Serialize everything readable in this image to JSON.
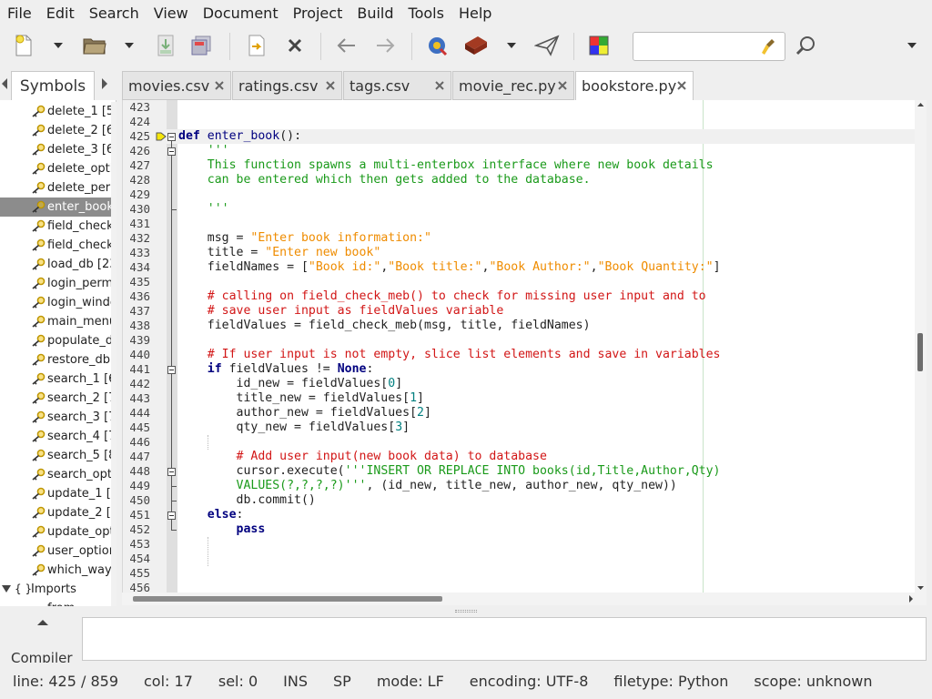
{
  "menu": [
    "File",
    "Edit",
    "Search",
    "View",
    "Document",
    "Project",
    "Build",
    "Tools",
    "Help"
  ],
  "toolbar": {
    "icons": [
      "new-file-icon",
      "new-dropdown-icon",
      "open-file-icon",
      "open-dropdown-icon",
      "save-icon",
      "save-all-icon",
      "revert-icon",
      "close-icon",
      "back-icon",
      "forward-icon",
      "compile-icon",
      "build-icon",
      "build-dropdown-icon",
      "run-icon",
      "color-chooser-icon"
    ],
    "search_value": ""
  },
  "sidebar": {
    "tab_label": "Symbols",
    "items": [
      "delete_1 [5",
      "delete_2 [6",
      "delete_3 [6",
      "delete_optic",
      "delete_perm",
      "enter_book",
      "field_check_",
      "field_check_",
      "load_db [23",
      "login_permi",
      "login_windo",
      "main_menu",
      "populate_dl",
      "restore_db",
      "search_1 [6",
      "search_2 [7",
      "search_3 [7",
      "search_4 [7",
      "search_5 [8",
      "search_opti",
      "update_1 [4",
      "update_2 [5",
      "update_opt",
      "user_option",
      "which_way"
    ],
    "selected_index": 5,
    "group_label": "Imports",
    "group_child": "from ..."
  },
  "tabs": [
    {
      "label": "movies.csv",
      "active": false
    },
    {
      "label": "ratings.csv",
      "active": false
    },
    {
      "label": "tags.csv",
      "active": false
    },
    {
      "label": "movie_rec.py",
      "active": false
    },
    {
      "label": "bookstore.py",
      "active": true
    }
  ],
  "editor": {
    "current_line": 425,
    "lines": [
      {
        "n": "423",
        "seg": []
      },
      {
        "n": "424",
        "seg": []
      },
      {
        "n": "425",
        "seg": [
          [
            "kw",
            "def"
          ],
          [
            "pl",
            " "
          ],
          [
            "fn",
            "enter_book"
          ],
          [
            "pl",
            "():"
          ]
        ]
      },
      {
        "n": "426",
        "seg": [
          [
            "pl",
            "    "
          ],
          [
            "doc",
            "'''"
          ]
        ]
      },
      {
        "n": "427",
        "seg": [
          [
            "pl",
            "    "
          ],
          [
            "doc",
            "This function spawns a multi-enterbox interface where new book details"
          ]
        ]
      },
      {
        "n": "428",
        "seg": [
          [
            "pl",
            "    "
          ],
          [
            "doc",
            "can be entered which then gets added to the database."
          ]
        ]
      },
      {
        "n": "429",
        "seg": []
      },
      {
        "n": "430",
        "seg": [
          [
            "pl",
            "    "
          ],
          [
            "doc",
            "'''"
          ]
        ]
      },
      {
        "n": "431",
        "seg": []
      },
      {
        "n": "432",
        "seg": [
          [
            "pl",
            "    msg = "
          ],
          [
            "str",
            "\"Enter book information:\""
          ]
        ]
      },
      {
        "n": "433",
        "seg": [
          [
            "pl",
            "    title = "
          ],
          [
            "str",
            "\"Enter new book\""
          ]
        ]
      },
      {
        "n": "434",
        "seg": [
          [
            "pl",
            "    fieldNames = ["
          ],
          [
            "str",
            "\"Book id:\""
          ],
          [
            "pl",
            ","
          ],
          [
            "str",
            "\"Book title:\""
          ],
          [
            "pl",
            ","
          ],
          [
            "str",
            "\"Book Author:\""
          ],
          [
            "pl",
            ","
          ],
          [
            "str",
            "\"Book Quantity:\""
          ],
          [
            "pl",
            "]"
          ]
        ]
      },
      {
        "n": "435",
        "seg": []
      },
      {
        "n": "436",
        "seg": [
          [
            "pl",
            "    "
          ],
          [
            "cmt",
            "# calling on field_check_meb() to check for missing user input and to"
          ]
        ]
      },
      {
        "n": "437",
        "seg": [
          [
            "pl",
            "    "
          ],
          [
            "cmt",
            "# save user input as fieldValues variable"
          ]
        ]
      },
      {
        "n": "438",
        "seg": [
          [
            "pl",
            "    fieldValues = field_check_meb(msg, title, fieldNames)"
          ]
        ]
      },
      {
        "n": "439",
        "seg": []
      },
      {
        "n": "440",
        "seg": [
          [
            "pl",
            "    "
          ],
          [
            "cmt",
            "# If user input is not empty, slice list elements and save in variables"
          ]
        ]
      },
      {
        "n": "441",
        "seg": [
          [
            "pl",
            "    "
          ],
          [
            "kw",
            "if"
          ],
          [
            "pl",
            " fieldValues != "
          ],
          [
            "kw",
            "None"
          ],
          [
            "pl",
            ":"
          ]
        ]
      },
      {
        "n": "442",
        "seg": [
          [
            "pl",
            "        id_new = fieldValues["
          ],
          [
            "num",
            "0"
          ],
          [
            "pl",
            "]"
          ]
        ]
      },
      {
        "n": "443",
        "seg": [
          [
            "pl",
            "        title_new = fieldValues["
          ],
          [
            "num",
            "1"
          ],
          [
            "pl",
            "]"
          ]
        ]
      },
      {
        "n": "444",
        "seg": [
          [
            "pl",
            "        author_new = fieldValues["
          ],
          [
            "num",
            "2"
          ],
          [
            "pl",
            "]"
          ]
        ]
      },
      {
        "n": "445",
        "seg": [
          [
            "pl",
            "        qty_new = fieldValues["
          ],
          [
            "num",
            "3"
          ],
          [
            "pl",
            "]"
          ]
        ]
      },
      {
        "n": "446",
        "seg": []
      },
      {
        "n": "447",
        "seg": [
          [
            "pl",
            "        "
          ],
          [
            "cmt",
            "# Add user input(new book data) to database"
          ]
        ]
      },
      {
        "n": "448",
        "seg": [
          [
            "pl",
            "        cursor.execute("
          ],
          [
            "doc",
            "'''INSERT OR REPLACE INTO books(id,Title,Author,Qty)"
          ]
        ]
      },
      {
        "n": "449",
        "seg": [
          [
            "pl",
            "        "
          ],
          [
            "doc",
            "VALUES(?,?,?,?)'''"
          ],
          [
            "pl",
            ", (id_new, title_new, author_new, qty_new))"
          ]
        ]
      },
      {
        "n": "450",
        "seg": [
          [
            "pl",
            "        db.commit()"
          ]
        ]
      },
      {
        "n": "451",
        "seg": [
          [
            "pl",
            "    "
          ],
          [
            "kw",
            "else"
          ],
          [
            "pl",
            ":"
          ]
        ]
      },
      {
        "n": "452",
        "seg": [
          [
            "pl",
            "        "
          ],
          [
            "kw",
            "pass"
          ]
        ]
      },
      {
        "n": "453",
        "seg": []
      },
      {
        "n": "454",
        "seg": []
      },
      {
        "n": "455",
        "seg": []
      },
      {
        "n": "456",
        "seg": []
      }
    ]
  },
  "bottom": {
    "tab_label": "Compiler"
  },
  "status": {
    "line": "line: 425 / 859",
    "col": "col: 17",
    "sel": "sel: 0",
    "ins": "INS",
    "sp": "SP",
    "mode": "mode: LF",
    "encoding": "encoding: UTF-8",
    "filetype": "filetype: Python",
    "scope": "scope: unknown"
  }
}
